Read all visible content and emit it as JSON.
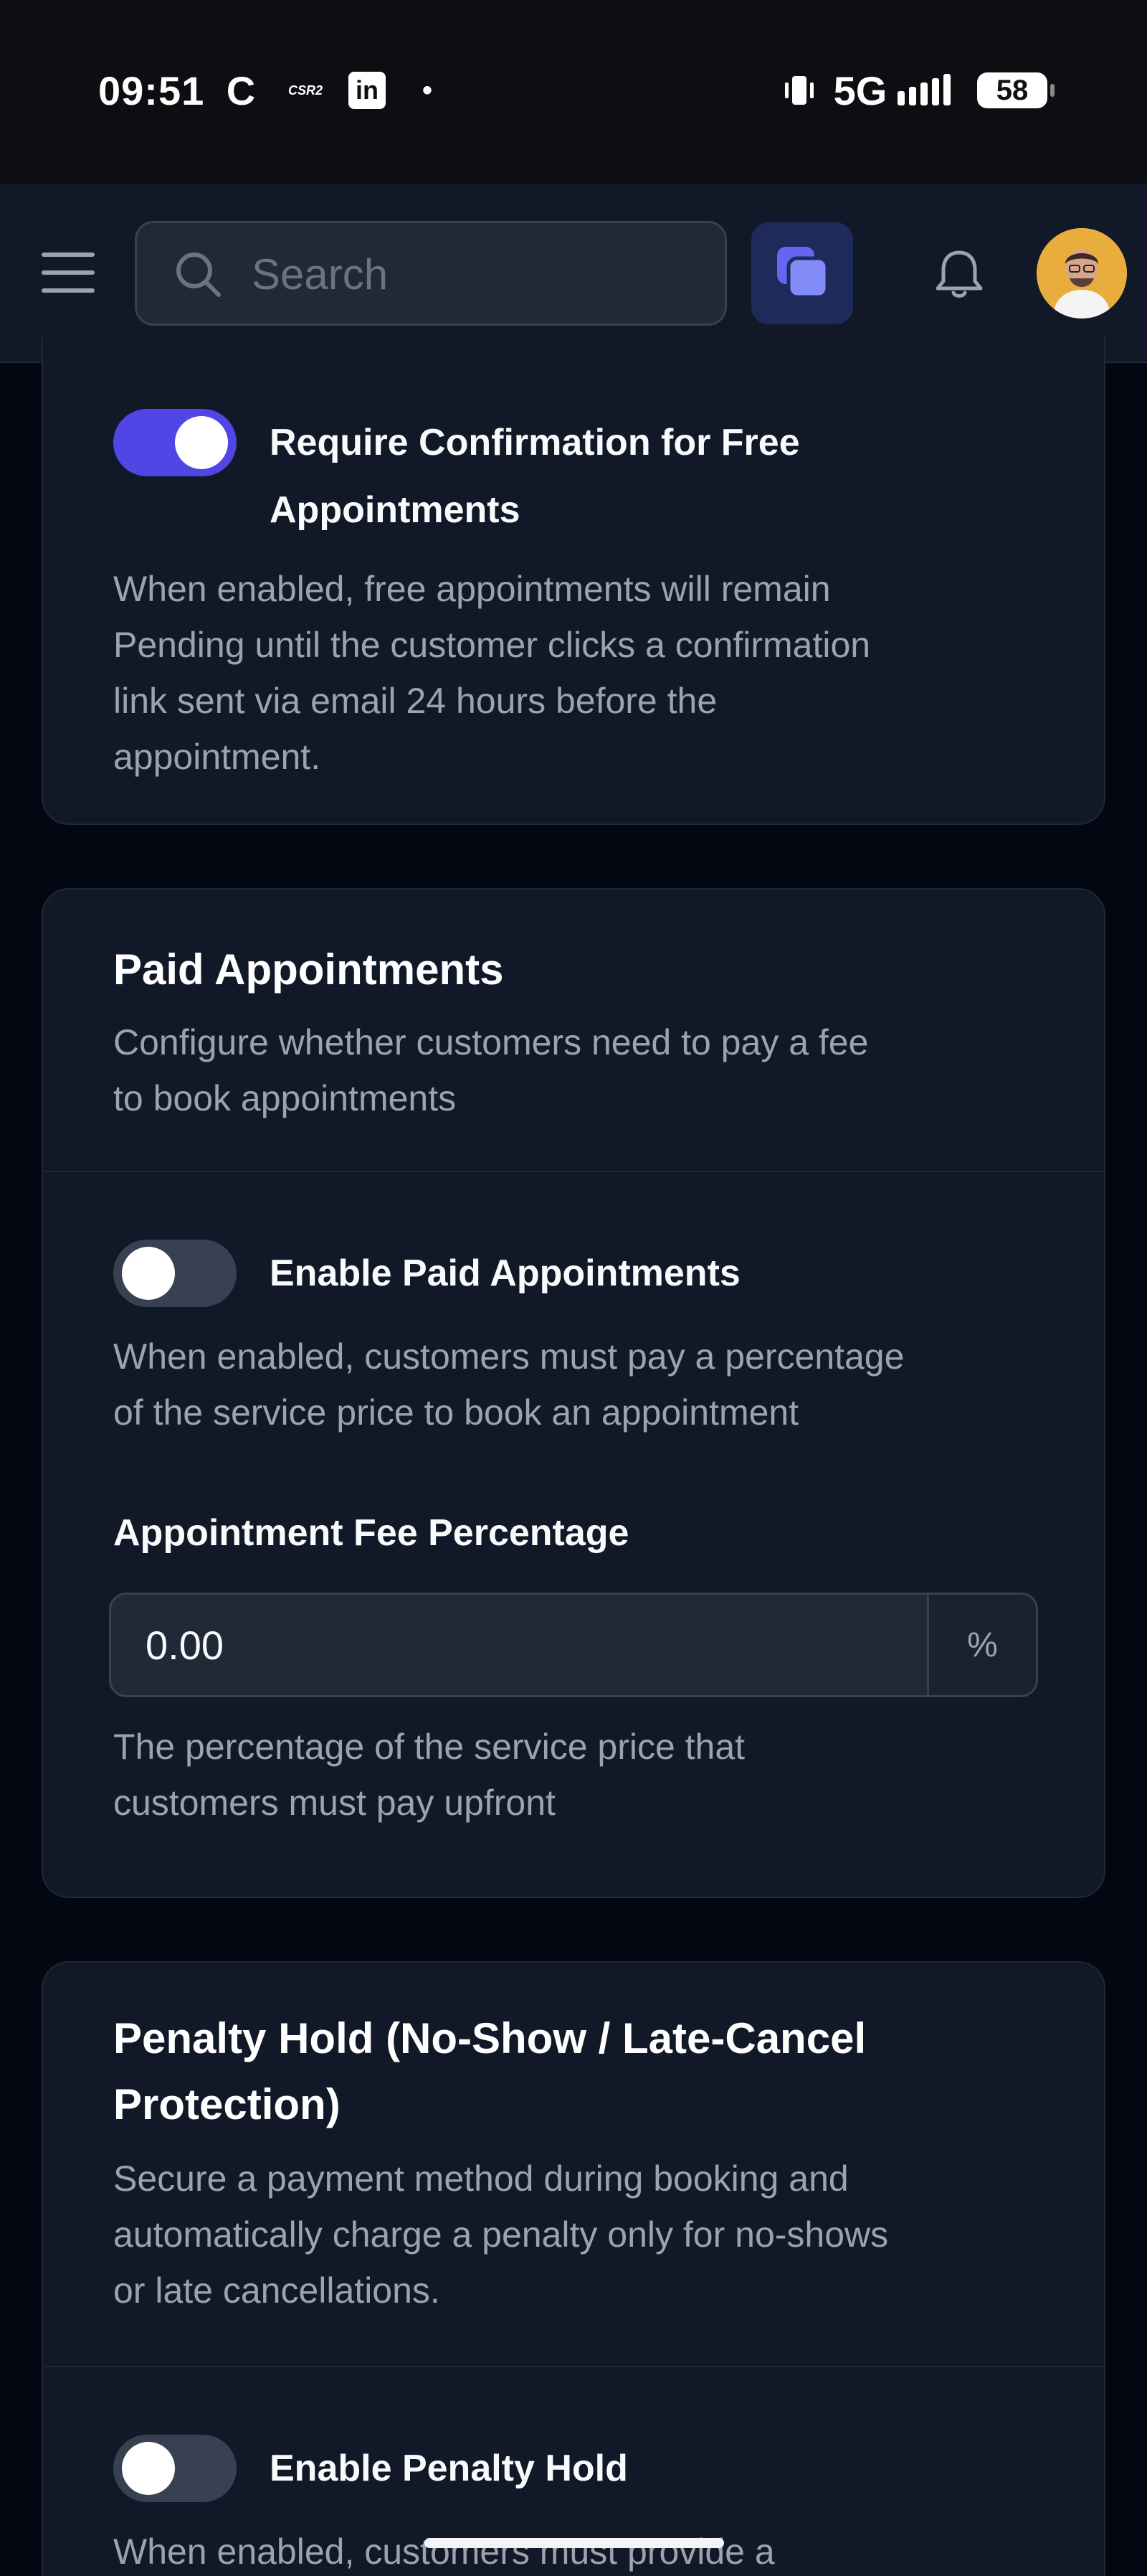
{
  "status_bar": {
    "time": "09:51",
    "app_icons": [
      "C",
      "CSR2",
      "in",
      "•"
    ],
    "network": "5G",
    "battery": "58"
  },
  "header": {
    "search_placeholder": "Search",
    "icons": [
      "hamburger-menu-icon",
      "search-icon",
      "apps-icon",
      "bell-icon",
      "avatar"
    ],
    "accent_color": "#4f46e5"
  },
  "free_confirmation": {
    "toggle_state": "on",
    "label_line1": "Require Confirmation for Free",
    "label_line2": "Appointments",
    "desc_lines": [
      "When enabled, free appointments will remain",
      "Pending until the customer clicks a confirmation",
      "link sent via email 24 hours before the",
      "appointment."
    ]
  },
  "paid": {
    "title": "Paid Appointments",
    "subtitle_lines": [
      "Configure whether customers need to pay a fee",
      "to book appointments"
    ],
    "toggle_state": "off",
    "toggle_label": "Enable Paid Appointments",
    "toggle_desc_lines": [
      "When enabled, customers must pay a percentage",
      "of the service price to book an appointment"
    ],
    "fee_label": "Appointment Fee Percentage",
    "fee_value": "0.00",
    "fee_suffix": "%",
    "fee_help_lines": [
      "The percentage of the service price that",
      "customers must pay upfront"
    ]
  },
  "penalty": {
    "title_line1": "Penalty Hold (No-Show / Late-Cancel",
    "title_line2": "Protection)",
    "subtitle_lines": [
      "Secure a payment method during booking and",
      "automatically charge a penalty only for no-shows",
      "or late cancellations."
    ],
    "toggle_state": "off",
    "toggle_label": "Enable Penalty Hold",
    "toggle_desc_partial": "When enabled, customers must provide a"
  }
}
